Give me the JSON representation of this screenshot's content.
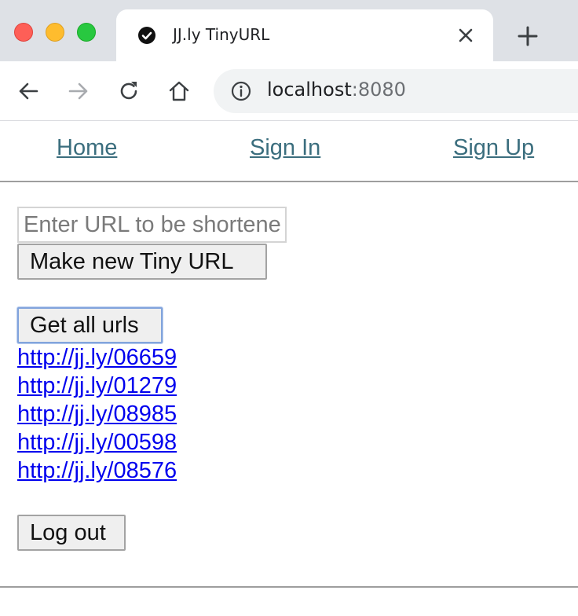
{
  "browser": {
    "tab_title": "JJ.ly TinyURL",
    "address": {
      "host": "localhost",
      "port": ":8080"
    },
    "icons": {
      "close": "close-icon",
      "new_tab": "plus-icon",
      "back": "back-arrow-icon",
      "forward": "forward-arrow-icon",
      "reload": "reload-icon",
      "home": "home-icon",
      "info": "info-icon",
      "favicon": "check-circle-icon"
    }
  },
  "nav": {
    "home": "Home",
    "sign_in": "Sign In",
    "sign_up": "Sign Up"
  },
  "form": {
    "url_placeholder": "Enter URL to be shortened",
    "url_value": "",
    "make_button": "Make new Tiny URL"
  },
  "urls": {
    "get_all_button": "Get all urls",
    "items": [
      "http://jj.ly/06659",
      "http://jj.ly/01279",
      "http://jj.ly/08985",
      "http://jj.ly/00598",
      "http://jj.ly/08576"
    ]
  },
  "logout_button": "Log out",
  "colors": {
    "nav_link": "#3b6e7e",
    "url_link": "#0000ee",
    "button_bg": "#efefef",
    "focus_ring": "#82a4dc"
  }
}
